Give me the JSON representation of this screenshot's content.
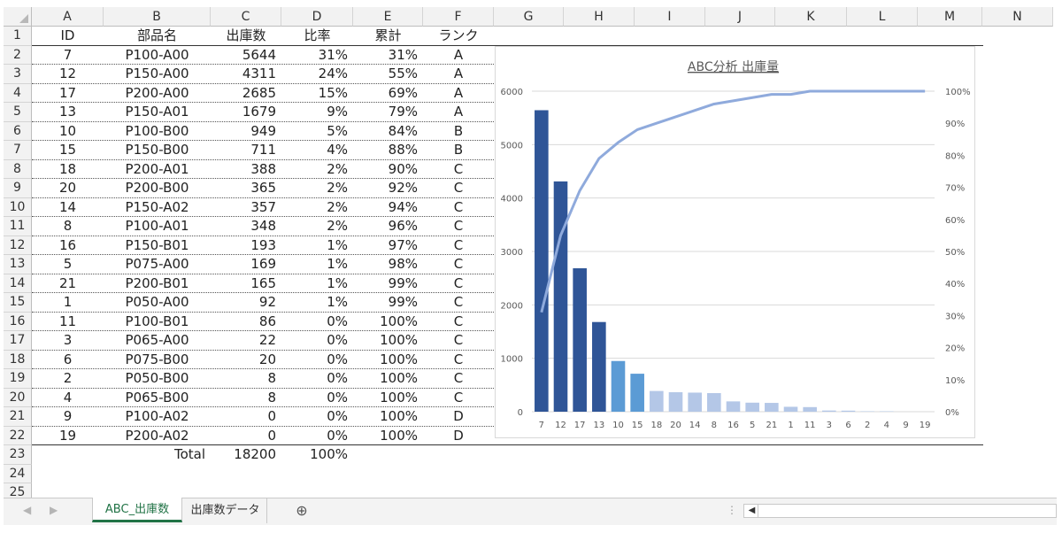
{
  "columns": [
    "A",
    "B",
    "C",
    "D",
    "E",
    "F",
    "G",
    "H",
    "I",
    "J",
    "K",
    "L",
    "M",
    "N"
  ],
  "row_numbers": [
    "1",
    "2",
    "3",
    "4",
    "5",
    "6",
    "7",
    "8",
    "9",
    "10",
    "11",
    "12",
    "13",
    "14",
    "15",
    "16",
    "17",
    "18",
    "19",
    "20",
    "21",
    "22",
    "23",
    "24",
    "25"
  ],
  "table": {
    "headers": [
      "ID",
      "部品名",
      "出庫数",
      "比率",
      "累計",
      "ランク"
    ],
    "rows": [
      [
        "7",
        "P100-A00",
        "5644",
        "31%",
        "31%",
        "A"
      ],
      [
        "12",
        "P150-A00",
        "4311",
        "24%",
        "55%",
        "A"
      ],
      [
        "17",
        "P200-A00",
        "2685",
        "15%",
        "69%",
        "A"
      ],
      [
        "13",
        "P150-A01",
        "1679",
        "9%",
        "79%",
        "A"
      ],
      [
        "10",
        "P100-B00",
        "949",
        "5%",
        "84%",
        "B"
      ],
      [
        "15",
        "P150-B00",
        "711",
        "4%",
        "88%",
        "B"
      ],
      [
        "18",
        "P200-A01",
        "388",
        "2%",
        "90%",
        "C"
      ],
      [
        "20",
        "P200-B00",
        "365",
        "2%",
        "92%",
        "C"
      ],
      [
        "14",
        "P150-A02",
        "357",
        "2%",
        "94%",
        "C"
      ],
      [
        "8",
        "P100-A01",
        "348",
        "2%",
        "96%",
        "C"
      ],
      [
        "16",
        "P150-B01",
        "193",
        "1%",
        "97%",
        "C"
      ],
      [
        "5",
        "P075-A00",
        "169",
        "1%",
        "98%",
        "C"
      ],
      [
        "21",
        "P200-B01",
        "165",
        "1%",
        "99%",
        "C"
      ],
      [
        "1",
        "P050-A00",
        "92",
        "1%",
        "99%",
        "C"
      ],
      [
        "11",
        "P100-B01",
        "86",
        "0%",
        "100%",
        "C"
      ],
      [
        "3",
        "P065-A00",
        "22",
        "0%",
        "100%",
        "C"
      ],
      [
        "6",
        "P075-B00",
        "20",
        "0%",
        "100%",
        "C"
      ],
      [
        "2",
        "P050-B00",
        "8",
        "0%",
        "100%",
        "C"
      ],
      [
        "4",
        "P065-B00",
        "8",
        "0%",
        "100%",
        "C"
      ],
      [
        "9",
        "P100-A02",
        "0",
        "0%",
        "100%",
        "D"
      ],
      [
        "19",
        "P200-A02",
        "0",
        "0%",
        "100%",
        "D"
      ]
    ],
    "total_label": "Total",
    "total_value": "18200",
    "total_ratio": "100%"
  },
  "tabs": {
    "active": "ABC_出庫数",
    "other": "出庫数データ",
    "add_symbol": "⊕"
  },
  "colors": {
    "rank_a": "#2f5597",
    "rank_b": "#5b9bd5",
    "rank_c": "#b4c7e7",
    "line": "#8faadc",
    "active_tab": "#217346"
  },
  "chart_data": {
    "type": "bar",
    "title": "ABC分析 出庫量",
    "categories": [
      "7",
      "12",
      "17",
      "13",
      "10",
      "15",
      "18",
      "20",
      "14",
      "8",
      "16",
      "5",
      "21",
      "1",
      "11",
      "3",
      "6",
      "2",
      "4",
      "9",
      "19"
    ],
    "series": [
      {
        "values": [
          5644,
          4311,
          2685,
          1679,
          949,
          711,
          388,
          365,
          357,
          348,
          193,
          169,
          165,
          92,
          86,
          22,
          20,
          8,
          8,
          0,
          0
        ]
      },
      {
        "type": "line",
        "axis": "right",
        "values": [
          31,
          55,
          69,
          79,
          84,
          88,
          90,
          92,
          94,
          96,
          97,
          98,
          99,
          99,
          100,
          100,
          100,
          100,
          100,
          100,
          100
        ]
      }
    ],
    "ylim": [
      0,
      6000
    ],
    "yticks": [
      "0",
      "1000",
      "2000",
      "3000",
      "4000",
      "5000",
      "6000"
    ],
    "y2lim": [
      0,
      100
    ],
    "y2ticks": [
      "0%",
      "10%",
      "20%",
      "30%",
      "40%",
      "50%",
      "60%",
      "70%",
      "80%",
      "90%",
      "100%"
    ],
    "grid": true,
    "legend": "none"
  }
}
